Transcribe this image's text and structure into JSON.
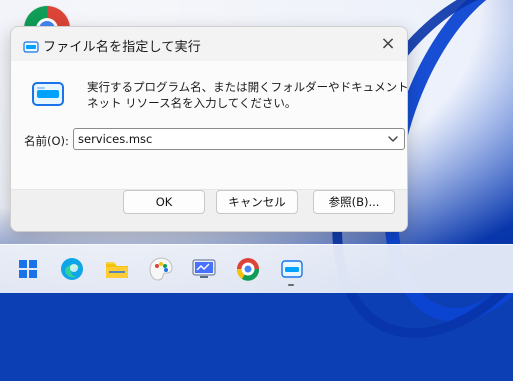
{
  "window": {
    "title": "ファイル名を指定して実行",
    "close_glyph": "×",
    "description_lines": [
      "実行するプログラム名、または開くフォルダーやドキュメント名、インター",
      "ネット リソース名を入力してください。"
    ],
    "name_label": "名前(O):",
    "name_value": "services.msc",
    "buttons": {
      "ok": "OK",
      "cancel": "キャンセル",
      "browse": "参照(B)..."
    }
  },
  "icons": {
    "title_icon": "run-icon",
    "big_icon": "run-icon-large",
    "dropdown": "chevron-down-icon",
    "desktop_icon": "chrome-icon"
  },
  "taskbar": {
    "items": [
      {
        "name": "start-icon"
      },
      {
        "name": "edge-icon"
      },
      {
        "name": "file-explorer-icon"
      },
      {
        "name": "paint-icon"
      },
      {
        "name": "remote-desktop-icon"
      },
      {
        "name": "chrome-icon"
      },
      {
        "name": "run-taskbar-icon"
      }
    ]
  },
  "colors": {
    "accent_blue": "#1a73e8",
    "dialog_bg": "#f3f3f3",
    "taskbar_bg": "#f0f3fa"
  }
}
